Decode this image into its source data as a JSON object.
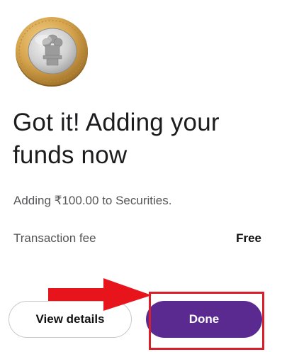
{
  "coin": {
    "icon": "rupee-coin-icon"
  },
  "headline": "Got it! Adding your funds now",
  "subtitle": "Adding ₹100.00 to Securities.",
  "fee": {
    "label": "Transaction fee",
    "value": "Free"
  },
  "buttons": {
    "view_details": "View details",
    "done": "Done"
  },
  "annotation": {
    "arrow_color": "#e8141c",
    "box_color": "#d9202a"
  },
  "colors": {
    "accent": "#5b2a91",
    "text": "#1c1c1e",
    "muted": "#555558"
  }
}
